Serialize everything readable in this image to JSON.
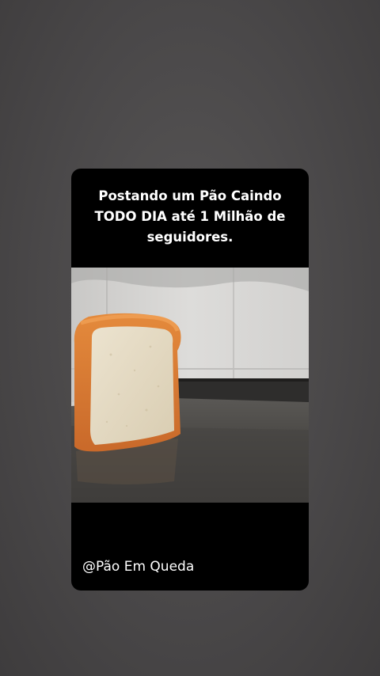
{
  "story": {
    "caption_lines": [
      "Postando um Pão Caindo",
      "TODO DIA até 1 Milhão de",
      "seguidores."
    ],
    "account_handle": "@Pão Em Queda"
  },
  "colors": {
    "backdrop": "#4a4849",
    "card": "#000000",
    "text": "#ffffff"
  }
}
